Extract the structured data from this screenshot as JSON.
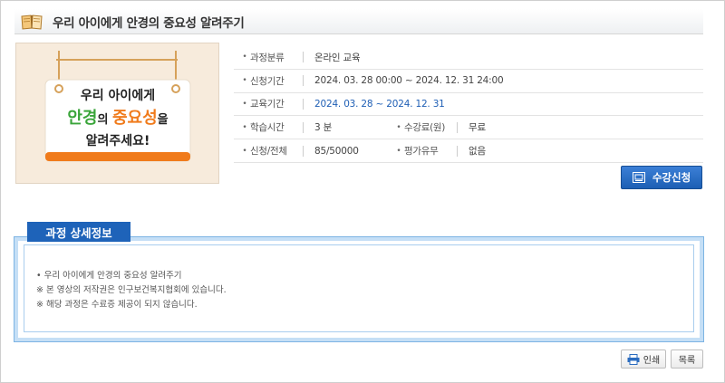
{
  "page": {
    "title": "우리 아이에게 안경의 중요성 알려주기"
  },
  "thumbnail": {
    "line1": "우리 아이에게",
    "line2_part1": "안경",
    "line2_part2": "의 ",
    "line2_part3": "중요성",
    "line2_part4": "을",
    "line3": "알려주세요!",
    "colors": {
      "green": "#3aa53a",
      "orange": "#f07b1c",
      "bg": "#f7ebdc"
    }
  },
  "info": {
    "category": {
      "label": "과정분류",
      "value": "온라인 교육"
    },
    "apply_period": {
      "label": "신청기간",
      "value": "2024. 03. 28 00:00 ~ 2024. 12. 31 24:00"
    },
    "edu_period": {
      "label": "교육기간",
      "value": "2024. 03. 28 ~ 2024. 12. 31"
    },
    "study_time": {
      "label": "학습시간",
      "value": "3 분"
    },
    "fee": {
      "label": "수강료(원)",
      "value": "무료"
    },
    "enrollment": {
      "label": "신청/전체",
      "value": "85/50000"
    },
    "evaluation": {
      "label": "평가유무",
      "value": "없음"
    }
  },
  "actions": {
    "apply_label": "수강신청",
    "print_label": "인쇄",
    "list_label": "목록"
  },
  "detail": {
    "tab_label": "과정 상세정보",
    "lines": [
      "• 우리 아이에게 안경의 중요성 알려주기",
      "※ 본 영상의 저작권은 인구보건복지협회에 있습니다.",
      "※ 해당 과정은 수료증 제공이 되지 않습니다."
    ]
  },
  "icons": {
    "title": "book-icon",
    "apply": "certificate-icon",
    "print": "printer-icon"
  },
  "colors": {
    "accent_blue": "#1e63b9",
    "date_blue": "#1f5fb5",
    "box_border": "#c5dff6"
  }
}
